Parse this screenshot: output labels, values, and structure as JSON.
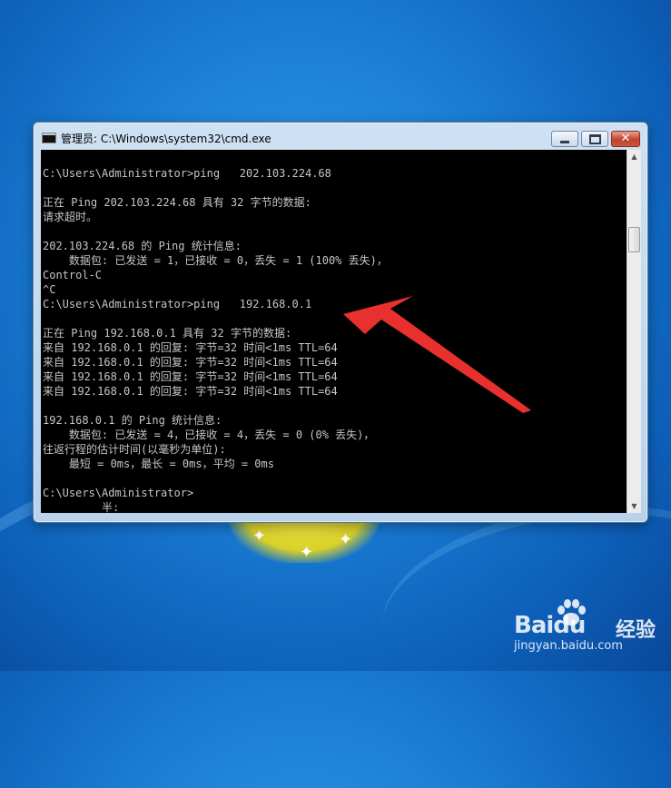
{
  "window": {
    "title": "管理员: C:\\Windows\\system32\\cmd.exe",
    "buttons": {
      "minimize": "minimize-icon",
      "maximize": "maximize-icon",
      "close": "close-icon"
    }
  },
  "console": {
    "lines": [
      "C:\\Users\\Administrator>ping   202.103.224.68",
      "",
      "正在 Ping 202.103.224.68 具有 32 字节的数据:",
      "请求超时。",
      "",
      "202.103.224.68 的 Ping 统计信息:",
      "    数据包: 已发送 = 1，已接收 = 0，丢失 = 1 (100% 丢失)，",
      "Control-C",
      "^C",
      "C:\\Users\\Administrator>ping   192.168.0.1",
      "",
      "正在 Ping 192.168.0.1 具有 32 字节的数据:",
      "来自 192.168.0.1 的回复: 字节=32 时间<1ms TTL=64",
      "来自 192.168.0.1 的回复: 字节=32 时间<1ms TTL=64",
      "来自 192.168.0.1 的回复: 字节=32 时间<1ms TTL=64",
      "来自 192.168.0.1 的回复: 字节=32 时间<1ms TTL=64",
      "",
      "192.168.0.1 的 Ping 统计信息:",
      "    数据包: 已发送 = 4，已接收 = 4，丢失 = 0 (0% 丢失)，",
      "往返行程的估计时间(以毫秒为单位):",
      "    最短 = 0ms，最长 = 0ms，平均 = 0ms",
      "",
      "C:\\Users\\Administrator>",
      "         半:"
    ]
  },
  "annotation": {
    "color": "#e8312f"
  },
  "watermark": {
    "brand": "Baidu",
    "product": "经验",
    "url": "jingyan.baidu.com"
  },
  "colors": {
    "console_bg": "#000000",
    "console_fg": "#c6c6c6",
    "desktop": "#1b7fd6"
  }
}
